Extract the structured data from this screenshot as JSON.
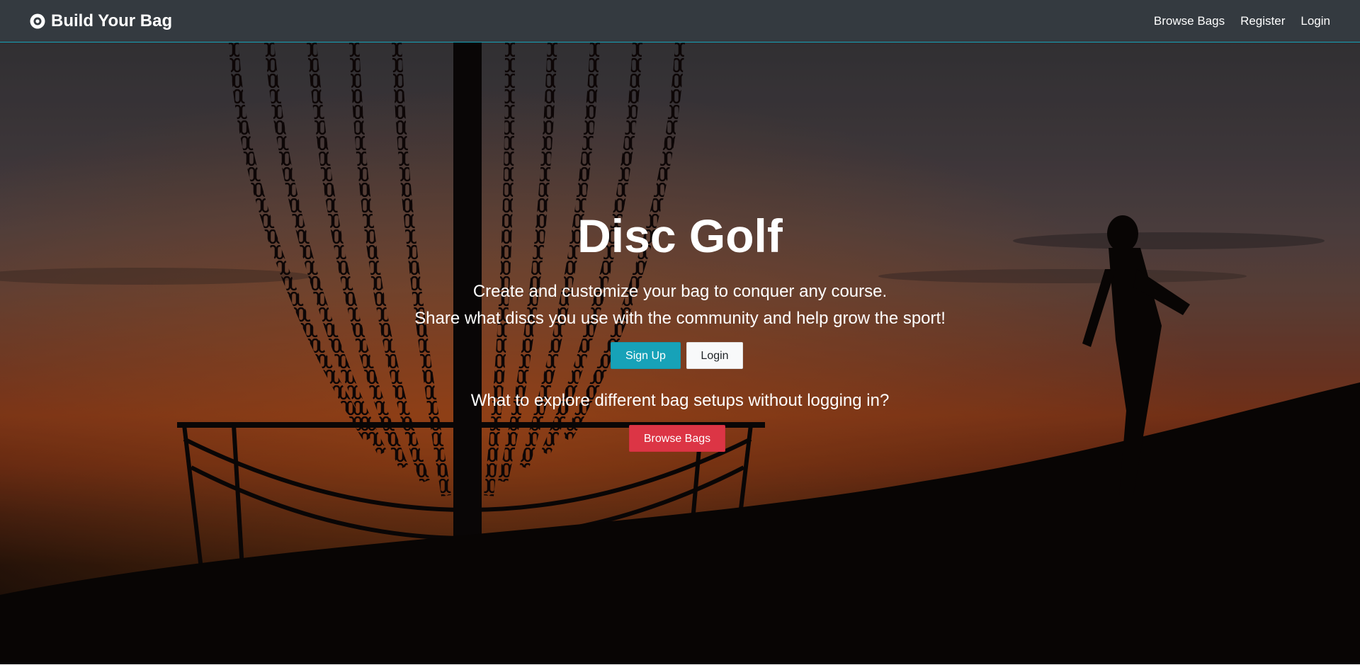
{
  "navbar": {
    "brand": "Build Your Bag",
    "brand_icon": "disc-icon",
    "links": [
      "Browse Bags",
      "Register",
      "Login"
    ],
    "background": "#343a40",
    "accent": "#17a2b8"
  },
  "hero": {
    "title": "Disc Golf",
    "line1": "Create and customize your bag to conquer any course.",
    "line2": "Share what discs you use with the community and help grow the sport!",
    "signup_label": "Sign Up",
    "login_label": "Login",
    "explore_text": "What to explore different bag setups without logging in?",
    "browse_label": "Browse Bags"
  },
  "colors": {
    "signup": "#17a2b8",
    "login": "#f8f9fa",
    "browse": "#dc3545"
  }
}
